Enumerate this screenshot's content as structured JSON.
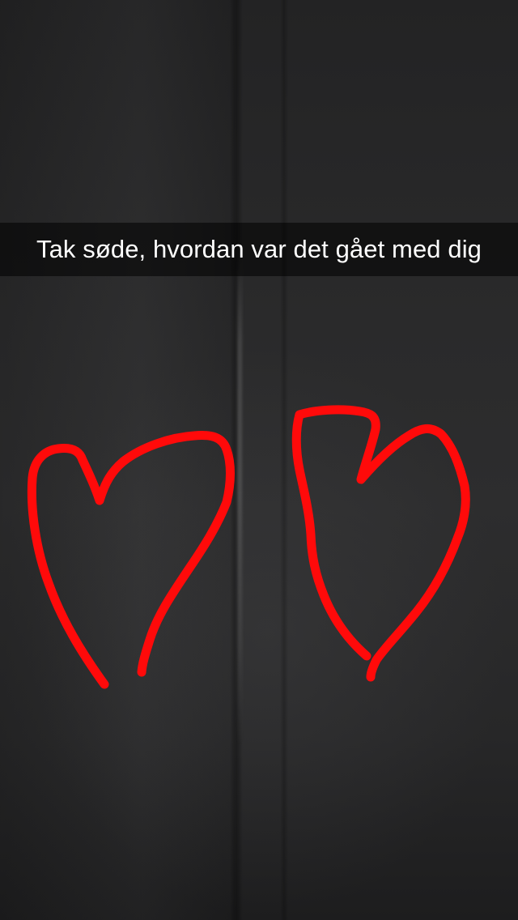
{
  "snap": {
    "caption": "Tak søde, hvordan var det gået med dig",
    "drawing": {
      "color": "#ff0a0a",
      "shapes": [
        "heart-left",
        "heart-right"
      ]
    }
  }
}
